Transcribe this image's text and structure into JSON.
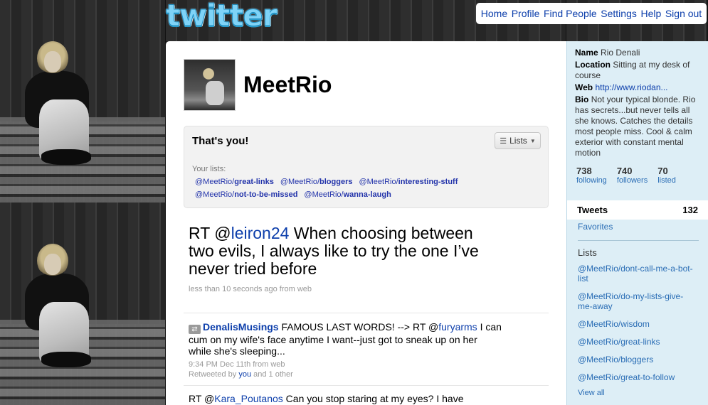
{
  "logo_text": "twitter",
  "nav": {
    "home": "Home",
    "profile": "Profile",
    "find_people": "Find People",
    "settings": "Settings",
    "help": "Help",
    "sign_out": "Sign out"
  },
  "profile": {
    "screen_name": "MeetRio",
    "thats_you": "That's you!",
    "lists_button": "Lists",
    "your_lists_label": "Your lists:",
    "list_rows": [
      [
        {
          "owner": "@MeetRio/",
          "name": "great-links"
        },
        {
          "owner": "@MeetRio/",
          "name": "bloggers"
        },
        {
          "owner": "@MeetRio/",
          "name": "interesting-stuff"
        }
      ],
      [
        {
          "owner": "@MeetRio/",
          "name": "not-to-be-missed"
        },
        {
          "owner": "@MeetRio/",
          "name": "wanna-laugh"
        }
      ]
    ]
  },
  "latest_tweet": {
    "prefix": "RT @",
    "mention": "leiron24",
    "body": " When choosing between two evils, I always like to try the one I’ve never tried before",
    "meta": "less than 10 seconds ago from web"
  },
  "timeline": [
    {
      "author": "DenalisMusings",
      "text_before": " FAMOUS LAST WORDS! --> RT @",
      "mention": "furyarms",
      "text_after": " I can cum on my wife's face anytime I want--just got to sneak up on her while she's sleeping...",
      "meta": "9:34 PM Dec 11th from web",
      "retweeted_by_prefix": "Retweeted by ",
      "retweeted_by_user": "you",
      "retweeted_by_suffix": " and 1 other"
    },
    {
      "text_before": "RT @",
      "mention": "Kara_Poutanos",
      "text_after": " Can you stop staring at my eyes? I have"
    }
  ],
  "sidebar": {
    "name_label": "Name",
    "name_value": "Rio Denali",
    "location_label": "Location",
    "location_value": "Sitting at my desk of course",
    "web_label": "Web",
    "web_value": "http://www.riodan...",
    "bio_label": "Bio",
    "bio_value": "Not your typical blonde. Rio has secrets...but never tells all she knows. Catches the details most people miss. Cool & calm exterior with constant mental motion",
    "stats": [
      {
        "num": "738",
        "label": "following"
      },
      {
        "num": "740",
        "label": "followers"
      },
      {
        "num": "70",
        "label": "listed"
      }
    ],
    "tweets_label": "Tweets",
    "tweets_count": "132",
    "favorites": "Favorites",
    "lists_heading": "Lists",
    "lists": [
      "@MeetRio/dont-call-me-a-bot-list",
      "@MeetRio/do-my-lists-give-me-away",
      "@MeetRio/wisdom",
      "@MeetRio/great-links",
      "@MeetRio/bloggers",
      "@MeetRio/great-to-follow"
    ],
    "view_all": "View all"
  }
}
